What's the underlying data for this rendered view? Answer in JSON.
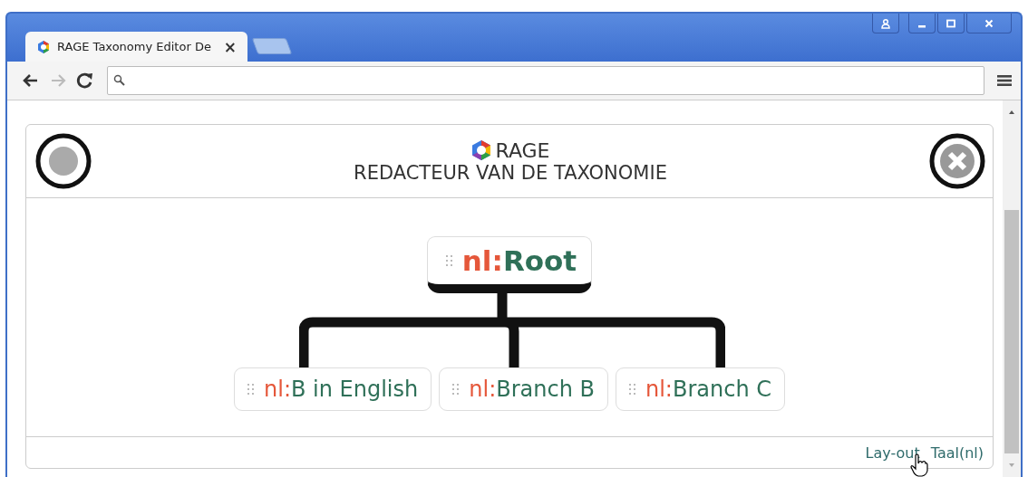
{
  "browser": {
    "tab_title": "RAGE Taxonomy Editor De",
    "tab_close": "×"
  },
  "header": {
    "logo_text": "RAGE",
    "title": "REDACTEUR VAN DE TAXONOMIE"
  },
  "tree": {
    "root": {
      "prefix": "nl:",
      "label": "Root"
    },
    "children": [
      {
        "prefix": "nl:",
        "label": "B in English"
      },
      {
        "prefix": "nl:",
        "label": "Branch B"
      },
      {
        "prefix": "nl:",
        "label": "Branch C"
      }
    ]
  },
  "footer": {
    "links": [
      "Lay-out",
      "Taal(nl)"
    ]
  }
}
